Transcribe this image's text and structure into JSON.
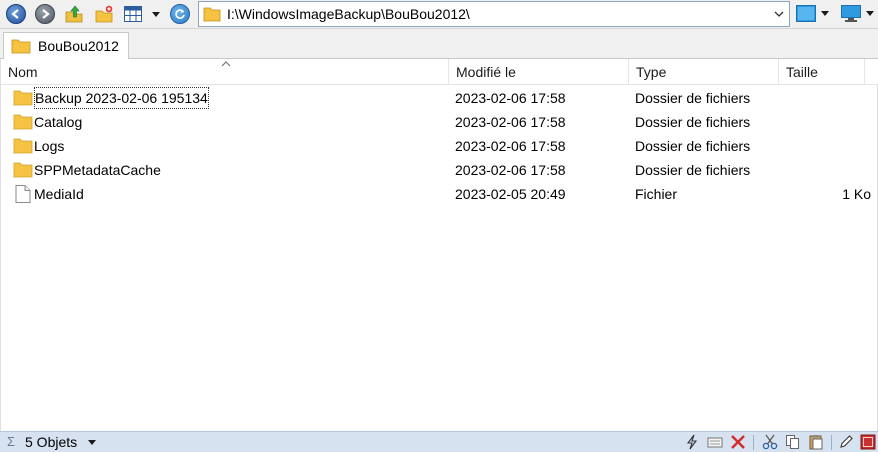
{
  "toolbar": {
    "address_path": "I:\\WindowsImageBackup\\BouBou2012\\"
  },
  "tabs": [
    {
      "label": "BouBou2012"
    }
  ],
  "columns": {
    "name": "Nom",
    "modified": "Modifié le",
    "type": "Type",
    "size": "Taille"
  },
  "rows": [
    {
      "icon": "folder-icon",
      "name": "Backup 2023-02-06 195134",
      "modified": "2023-02-06 17:58",
      "type": "Dossier de fichiers",
      "size": ""
    },
    {
      "icon": "folder-icon",
      "name": "Catalog",
      "modified": "2023-02-06 17:58",
      "type": "Dossier de fichiers",
      "size": ""
    },
    {
      "icon": "folder-icon",
      "name": "Logs",
      "modified": "2023-02-06 17:58",
      "type": "Dossier de fichiers",
      "size": ""
    },
    {
      "icon": "folder-icon",
      "name": "SPPMetadataCache",
      "modified": "2023-02-06 17:58",
      "type": "Dossier de fichiers",
      "size": ""
    },
    {
      "icon": "file-icon",
      "name": "MediaId",
      "modified": "2023-02-05 20:49",
      "type": "Fichier",
      "size": "1 Ko"
    }
  ],
  "status": {
    "sigma": "Σ",
    "count_label": "5 Objets"
  },
  "colors": {
    "folder": "#f5c242",
    "status_bar": "#d6e2f0",
    "accent_blue": "#2a7cc7"
  }
}
